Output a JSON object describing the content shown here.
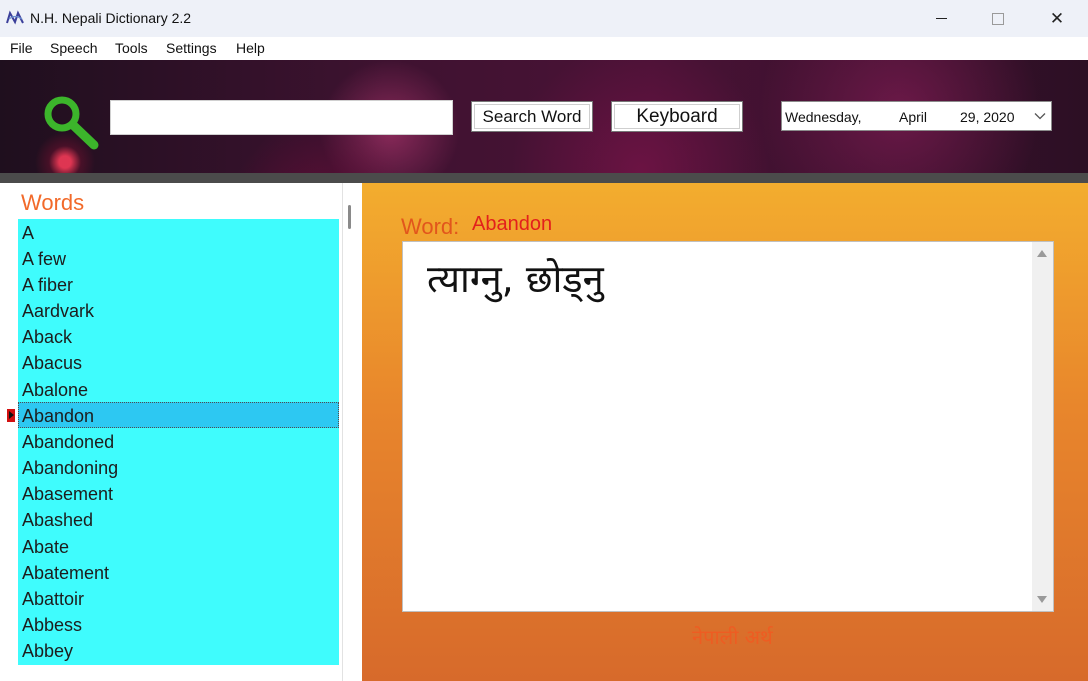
{
  "window": {
    "title": "N.H. Nepali Dictionary 2.2",
    "close_symbol": "✕"
  },
  "menu": {
    "items": [
      "File",
      "Speech",
      "Tools",
      "Settings",
      "Help"
    ]
  },
  "toolbar": {
    "search_value": "",
    "search_button_label": "Search Word",
    "keyboard_button_label": "Keyboard",
    "date": {
      "weekday": "Wednesday,",
      "month": "April",
      "day_year": "29, 2020"
    }
  },
  "word_list": {
    "heading": "Words",
    "items": [
      "A",
      "A few",
      "A fiber",
      "Aardvark",
      "Aback",
      "Abacus",
      "Abalone",
      "Abandon",
      "Abandoned",
      "Abandoning",
      "Abasement",
      "Abashed",
      "Abate",
      "Abatement",
      "Abattoir",
      "Abbess",
      "Abbey"
    ],
    "selected_index": 7
  },
  "definition": {
    "word_label": "Word:",
    "word_value": "Abandon",
    "meaning": "त्याग्नु, छोड्नु",
    "footer_label": "नेपाली अर्थ"
  },
  "colors": {
    "list_background": "#3ffcfd",
    "list_selected": "#2dc8f2",
    "accent_orange": "#f26a2a",
    "word_red": "#e3201c",
    "icon_green": "#3cb52b"
  },
  "icons": {
    "app": "nh-logo-icon",
    "search": "magnifier-icon",
    "date_dropdown": "chevron-down-icon",
    "row_marker": "current-row-icon"
  }
}
